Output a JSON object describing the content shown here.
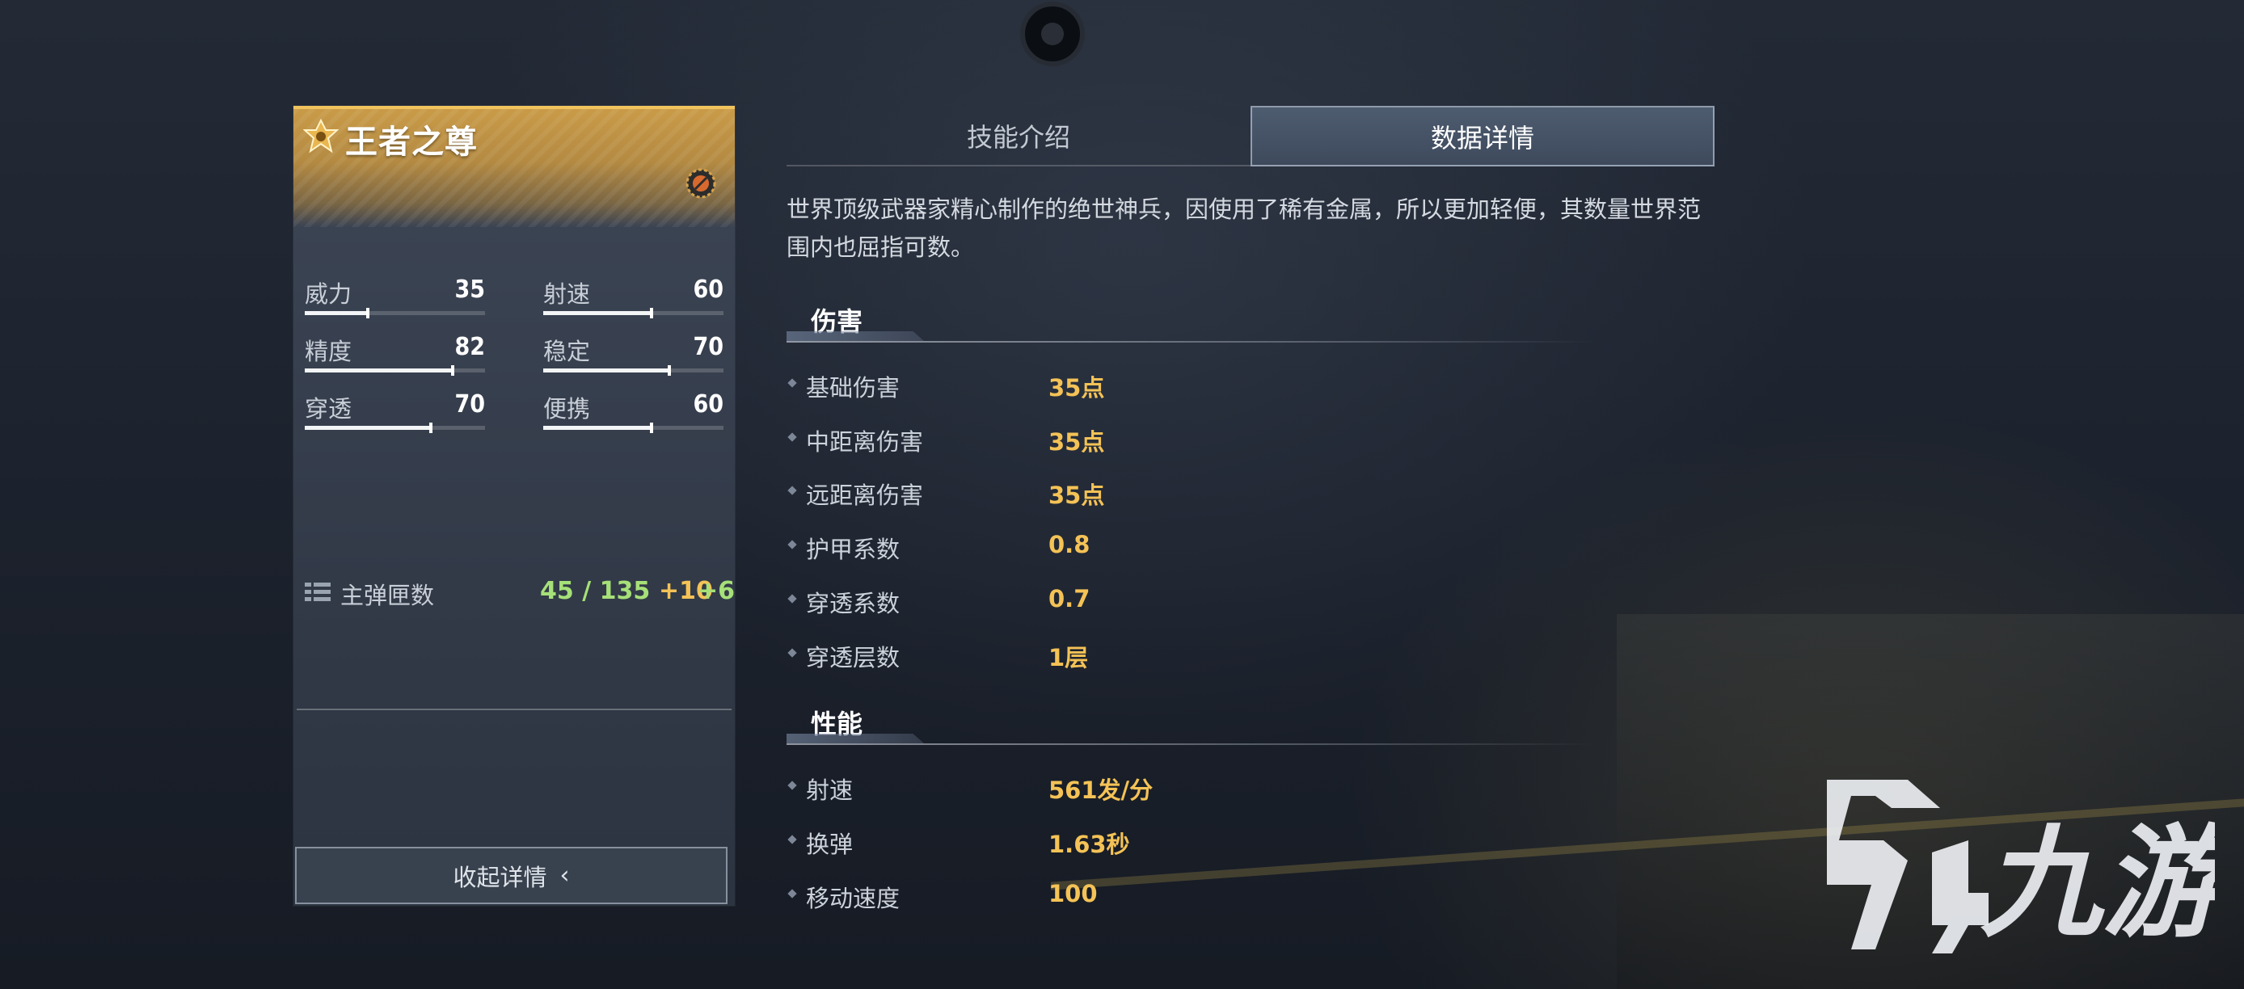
{
  "card": {
    "title": "王者之尊",
    "stats": [
      {
        "label": "威力",
        "value": "35",
        "level": 0.35
      },
      {
        "label": "射速",
        "value": "60",
        "level": 0.6
      },
      {
        "label": "精度",
        "value": "82",
        "level": 0.82
      },
      {
        "label": "稳定",
        "value": "70",
        "level": 0.7
      },
      {
        "label": "穿透",
        "value": "70",
        "level": 0.7
      },
      {
        "label": "便携",
        "value": "60",
        "level": 0.6
      }
    ],
    "ammo": {
      "label": "主弹匣数",
      "value": "45 / 135",
      "bonus1": "+10",
      "bonus2": "+6"
    },
    "collapse_label": "收起详情",
    "collapse_chevron": "‹"
  },
  "tabs": [
    {
      "label": "技能介绍",
      "active": false
    },
    {
      "label": "数据详情",
      "active": true
    }
  ],
  "description": "世界顶级武器家精心制作的绝世神兵，因使用了稀有金属，所以更加轻便，其数量世界范围内也屈指可数。",
  "sections": [
    {
      "title": "伤害",
      "rows": [
        {
          "label": "基础伤害",
          "value": "35点"
        },
        {
          "label": "中距离伤害",
          "value": "35点"
        },
        {
          "label": "远距离伤害",
          "value": "35点"
        },
        {
          "label": "护甲系数",
          "value": "0.8"
        },
        {
          "label": "穿透系数",
          "value": "0.7"
        },
        {
          "label": "穿透层数",
          "value": "1层"
        }
      ]
    },
    {
      "title": "性能",
      "rows": [
        {
          "label": "射速",
          "value": "561发/分"
        },
        {
          "label": "换弹",
          "value": "1.63秒"
        },
        {
          "label": "移动速度",
          "value": "100"
        }
      ]
    }
  ],
  "watermark": {
    "text": "九游"
  },
  "colors": {
    "accent_gold": "#f4c256",
    "green": "#a6e078",
    "card_header": "#c99b48"
  }
}
